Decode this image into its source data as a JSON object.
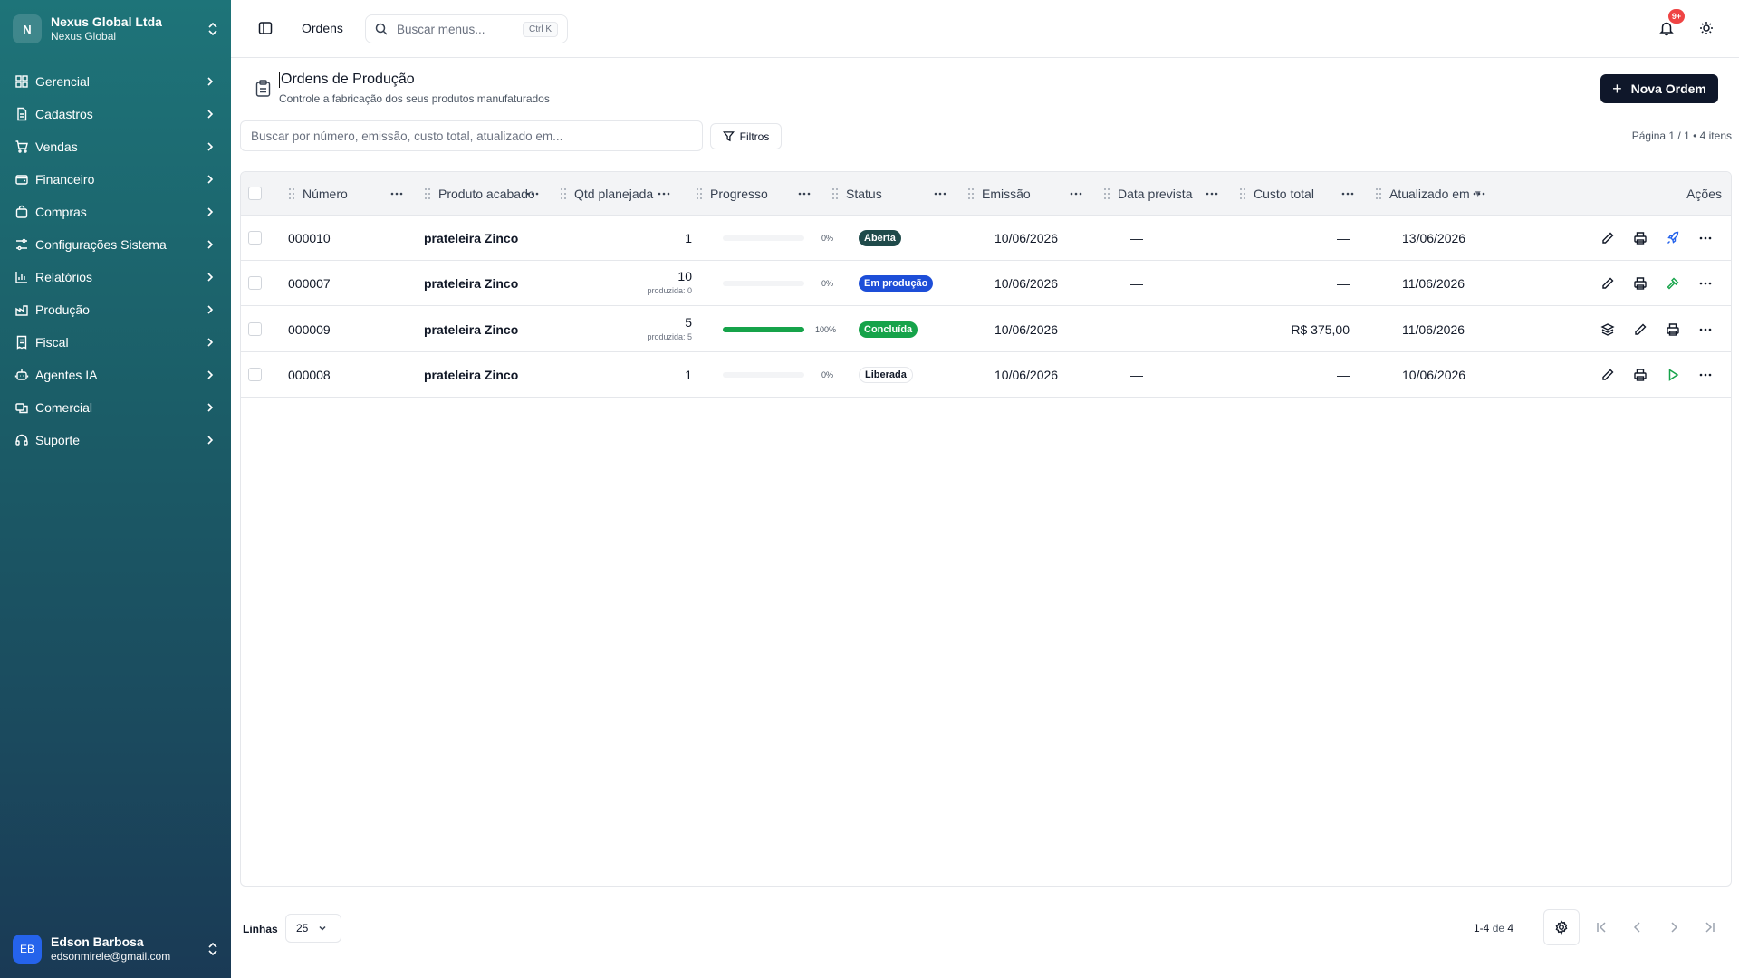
{
  "sidebar": {
    "org_initial": "N",
    "org_name": "Nexus Global Ltda",
    "org_sub": "Nexus Global",
    "items": [
      {
        "label": "Gerencial",
        "icon": "dashboard-icon"
      },
      {
        "label": "Cadastros",
        "icon": "file-icon"
      },
      {
        "label": "Vendas",
        "icon": "cart-icon"
      },
      {
        "label": "Financeiro",
        "icon": "wallet-icon"
      },
      {
        "label": "Compras",
        "icon": "shopping-bag-icon"
      },
      {
        "label": "Configurações Sistema",
        "icon": "sliders-icon"
      },
      {
        "label": "Relatórios",
        "icon": "bar-chart-icon"
      },
      {
        "label": "Produção",
        "icon": "factory-icon"
      },
      {
        "label": "Fiscal",
        "icon": "receipt-icon"
      },
      {
        "label": "Agentes IA",
        "icon": "robot-icon"
      },
      {
        "label": "Comercial",
        "icon": "handshake-icon"
      },
      {
        "label": "Suporte",
        "icon": "headset-icon"
      }
    ],
    "user_initials": "EB",
    "user_name": "Edson Barbosa",
    "user_email": "edsonmirele@gmail.com"
  },
  "topbar": {
    "breadcrumb": "Ordens",
    "search_placeholder": "Buscar menus...",
    "search_shortcut": "Ctrl K",
    "notifications_badge": "9+"
  },
  "header": {
    "title": "Ordens de Produção",
    "subtitle": "Controle a fabricação dos seus produtos manufaturados",
    "new_button": "Nova Ordem"
  },
  "filters": {
    "search_placeholder": "Buscar por número, emissão, custo total, atualizado em...",
    "filters_label": "Filtros",
    "page_info": "Página 1 / 1 • 4 itens"
  },
  "table": {
    "columns": [
      "Número",
      "Produto acabado",
      "Qtd planejada",
      "Progresso",
      "Status",
      "Emissão",
      "Data prevista",
      "Custo total",
      "Atualizado em",
      "Ações"
    ],
    "sort_indicator": "▼",
    "rows": [
      {
        "numero": "000010",
        "produto": "prateleira Zinco",
        "qtd": "1",
        "produzida": "",
        "progress": 0,
        "pct": "0%",
        "status": "Aberta",
        "status_kind": "aberta",
        "emissao": "10/06/2026",
        "prevista": "—",
        "custo": "—",
        "atualizado": "13/06/2026"
      },
      {
        "numero": "000007",
        "produto": "prateleira Zinco",
        "qtd": "10",
        "produzida": "produzida: 0",
        "progress": 0,
        "pct": "0%",
        "status": "Em produção",
        "status_kind": "prod",
        "emissao": "10/06/2026",
        "prevista": "—",
        "custo": "—",
        "atualizado": "11/06/2026"
      },
      {
        "numero": "000009",
        "produto": "prateleira Zinco",
        "qtd": "5",
        "produzida": "produzida: 5",
        "progress": 100,
        "pct": "100%",
        "status": "Concluída",
        "status_kind": "conc",
        "emissao": "10/06/2026",
        "prevista": "—",
        "custo": "R$ 375,00",
        "atualizado": "11/06/2026"
      },
      {
        "numero": "000008",
        "produto": "prateleira Zinco",
        "qtd": "1",
        "produzida": "",
        "progress": 0,
        "pct": "0%",
        "status": "Liberada",
        "status_kind": "lib",
        "emissao": "10/06/2026",
        "prevista": "—",
        "custo": "—",
        "atualizado": "10/06/2026"
      }
    ]
  },
  "footer": {
    "rows_label": "Linhas",
    "rows_value": "25",
    "range": "1-4",
    "range_of": "de",
    "range_total": "4"
  },
  "colors": {
    "accent": "#0f172a",
    "success": "#16a34a",
    "info": "#1d4ed8",
    "danger": "#ef4444"
  }
}
